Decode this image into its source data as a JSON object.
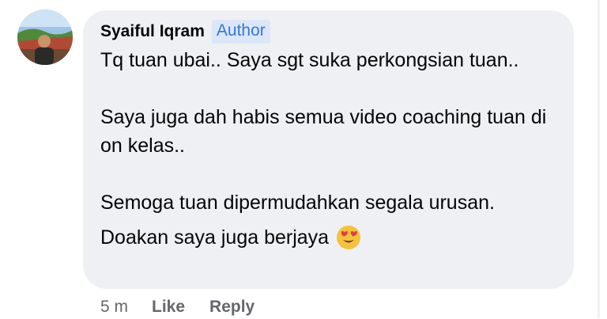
{
  "comment": {
    "author_name": "Syaiful Iqram",
    "author_badge": "Author",
    "avatar_icon": "profile-photo-avatar",
    "paragraphs": [
      "Tq tuan ubai.. Saya sgt suka perkongsian tuan..",
      "Saya juga dah habis semua video coaching tuan di on kelas..",
      "Semoga tuan dipermudahkan segala urusan."
    ],
    "last_line": "Doakan saya juga berjaya",
    "emoji_icon": "heart-eyes-emoji-icon",
    "timestamp": "5 m",
    "like_label": "Like",
    "reply_label": "Reply"
  },
  "colors": {
    "bubble": "#eff0f4",
    "badge_bg": "#dbe7f9",
    "badge_text": "#3577dc",
    "meta_text": "#65676b"
  }
}
